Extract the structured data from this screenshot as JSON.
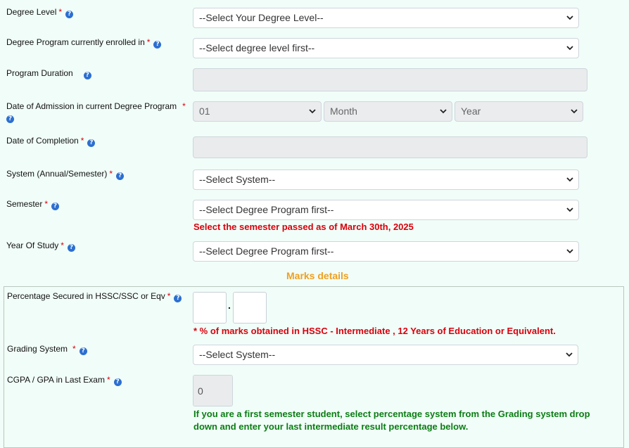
{
  "fields": {
    "degree_level": {
      "label": "Degree Level",
      "value": "--Select Your Degree Level--"
    },
    "degree_program": {
      "label": "Degree Program currently enrolled in",
      "value": "--Select degree level first--"
    },
    "program_duration": {
      "label": "Program Duration",
      "value": ""
    },
    "admission_date": {
      "label": "Date of Admission in current Degree Program",
      "day": "01",
      "month": "Month",
      "year": "Year"
    },
    "completion_date": {
      "label": "Date of Completion",
      "value": ""
    },
    "system": {
      "label": "System (Annual/Semester)",
      "value": "--Select System--"
    },
    "semester": {
      "label": "Semester",
      "value": "--Select Degree Program first--",
      "note": "Select the semester passed as of March 30th, 2025"
    },
    "year_of_study": {
      "label": "Year Of Study",
      "value": "--Select Degree Program first--"
    }
  },
  "marks": {
    "section_title": "Marks details",
    "percentage": {
      "label": "Percentage Secured in HSSC/SSC or Eqv",
      "separator": ".",
      "note": "* % of marks obtained in HSSC - Intermediate , 12 Years of Education or Equivalent."
    },
    "grading_system": {
      "label": "Grading System",
      "value": "--Select System--"
    },
    "cgpa": {
      "label": "CGPA / GPA in Last Exam",
      "value": "0",
      "note_line1": "If you are a first semester student, select percentage system from the Grading system drop",
      "note_line2": "down and enter your last intermediate result percentage below."
    }
  },
  "ui": {
    "required_mark": "*",
    "help_glyph": "?"
  },
  "colors": {
    "background": "#f1fdf8",
    "required": "#d8000c",
    "help_icon": "#2c6fd1",
    "section_title": "#f0a020",
    "green_note": "#0a7d14"
  }
}
